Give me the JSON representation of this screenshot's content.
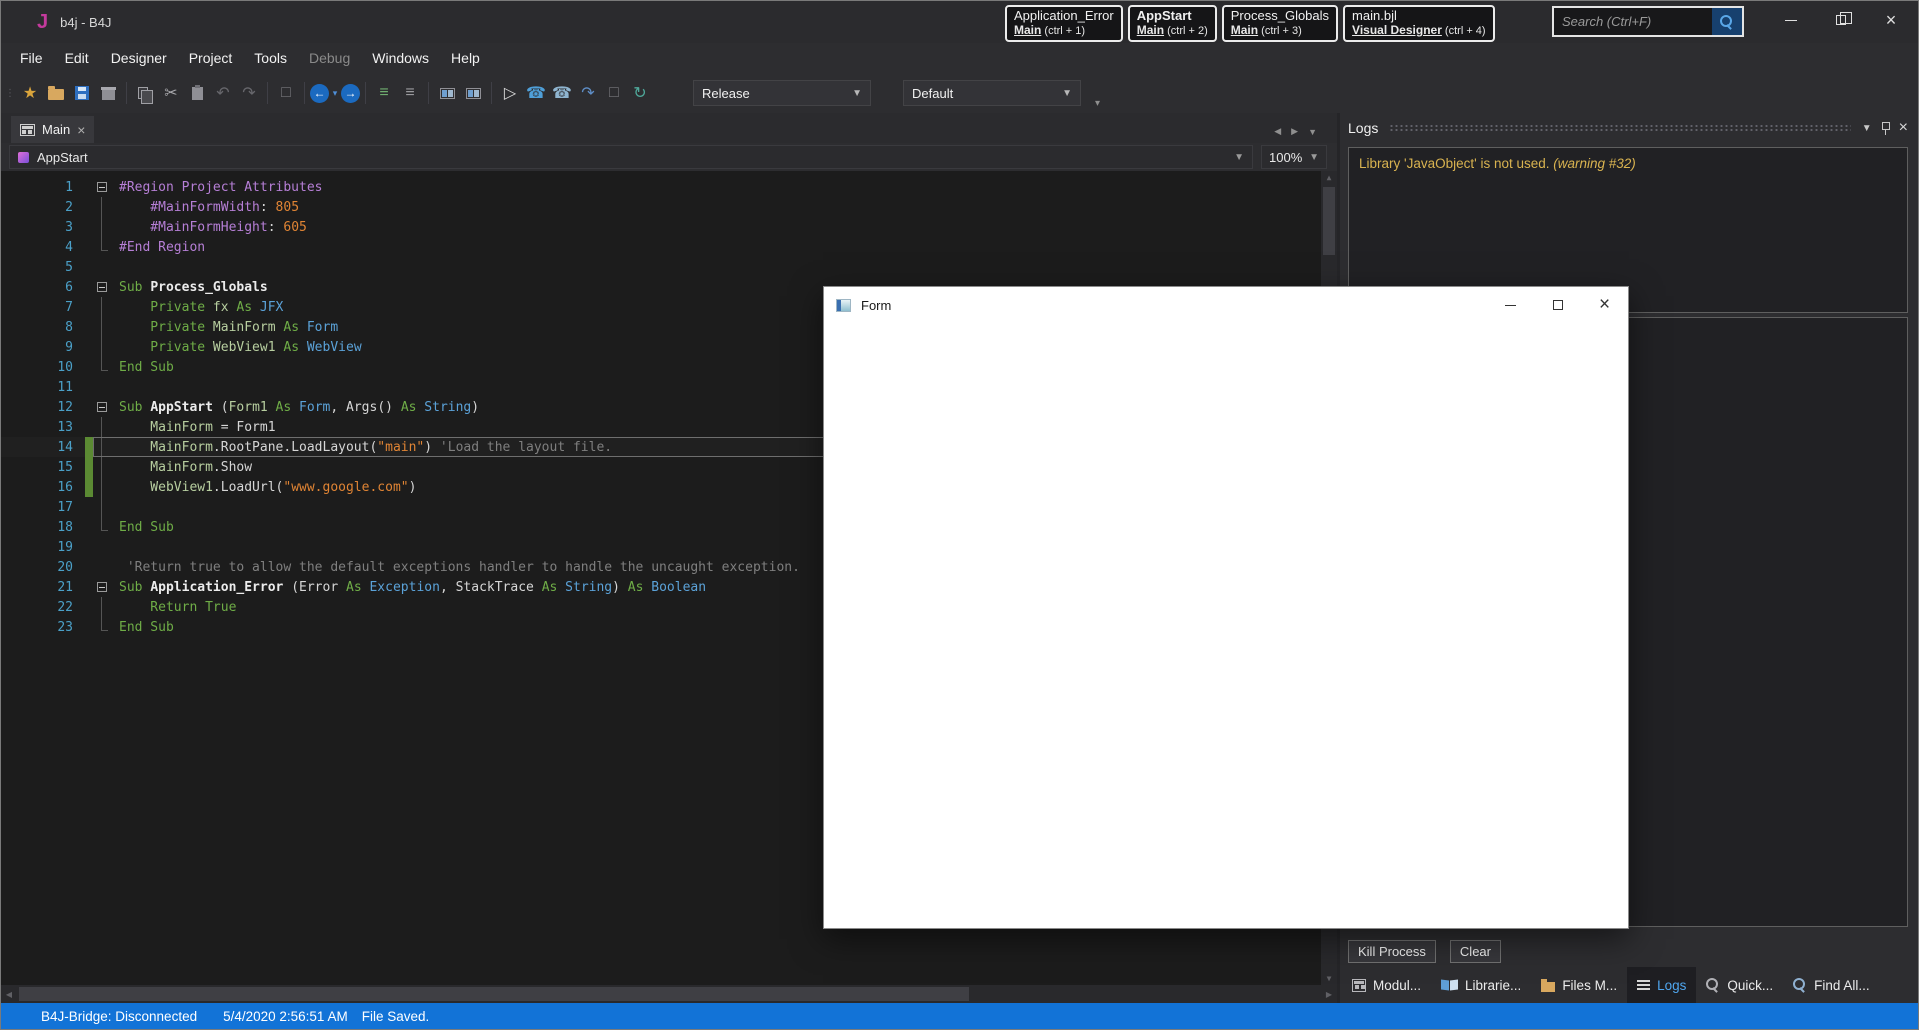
{
  "window": {
    "logo": "J",
    "title": "b4j - B4J"
  },
  "title_tabs": [
    {
      "line1": "Application_Error",
      "line2_main": "Main",
      "line2_hint": "(ctrl + 1)",
      "active": false
    },
    {
      "line1": "AppStart",
      "line2_main": "Main",
      "line2_hint": "(ctrl + 2)",
      "active": true
    },
    {
      "line1": "Process_Globals",
      "line2_main": "Main",
      "line2_hint": "(ctrl + 3)",
      "active": false
    },
    {
      "line1": "main.bjl",
      "line2_main": "Visual Designer",
      "line2_hint": "(ctrl + 4)",
      "active": false
    }
  ],
  "search": {
    "placeholder": "Search (Ctrl+F)"
  },
  "menubar": {
    "items": [
      {
        "label": "File",
        "enabled": true
      },
      {
        "label": "Edit",
        "enabled": true
      },
      {
        "label": "Designer",
        "enabled": true
      },
      {
        "label": "Project",
        "enabled": true
      },
      {
        "label": "Tools",
        "enabled": true
      },
      {
        "label": "Debug",
        "enabled": false
      },
      {
        "label": "Windows",
        "enabled": true
      },
      {
        "label": "Help",
        "enabled": true
      }
    ]
  },
  "toolbar": {
    "build_config": "Release",
    "run_config": "Default",
    "icons": [
      {
        "name": "new-project-icon",
        "glyph": "★",
        "color": "#d9a43c"
      },
      {
        "name": "open-project-icon",
        "css": "i-folder"
      },
      {
        "name": "save-icon",
        "css": "i-floppy"
      },
      {
        "name": "export-package-icon",
        "css": "i-package"
      },
      {
        "sep": true
      },
      {
        "name": "copy-icon",
        "css": "i-copy"
      },
      {
        "name": "cut-icon",
        "glyph": "✂",
        "color": "#a8a8ac"
      },
      {
        "name": "paste-icon",
        "css": "i-paste"
      },
      {
        "name": "undo-icon",
        "glyph": "↶",
        "color": "#67676c"
      },
      {
        "name": "redo-icon",
        "glyph": "↷",
        "color": "#67676c"
      },
      {
        "sep": true
      },
      {
        "name": "bookmark-icon",
        "glyph": "□",
        "color": "#77777c"
      },
      {
        "sep": true
      },
      {
        "name": "navigate-back-icon",
        "css": "i-circ",
        "glyph": "←"
      },
      {
        "name": "back-history-caret",
        "glyph": "▾",
        "color": "#4f8fd8",
        "small": true
      },
      {
        "name": "navigate-forward-icon",
        "css": "i-circ",
        "glyph": "→"
      },
      {
        "sep": true
      },
      {
        "name": "outline-icon",
        "glyph": "≡",
        "color": "#6fad6f"
      },
      {
        "name": "numbered-list-icon",
        "glyph": "≡",
        "color": "#9a9a9e"
      },
      {
        "sep": true
      },
      {
        "name": "split-editor-icon",
        "css": "i-panes"
      },
      {
        "name": "compare-modules-icon",
        "css": "i-panes"
      },
      {
        "sep": true
      },
      {
        "name": "run-icon",
        "glyph": "▷",
        "color": "#d8d8d8"
      },
      {
        "name": "bridge-icon",
        "glyph": "☎",
        "color": "#4f9fd8"
      },
      {
        "name": "wireless-bridge-icon",
        "glyph": "☎",
        "color": "#8fb5d0"
      },
      {
        "name": "resume-icon",
        "glyph": "↷",
        "color": "#5f8fc8"
      },
      {
        "name": "pause-icon",
        "glyph": "□",
        "color": "#77777c"
      },
      {
        "name": "rebuild-icon",
        "glyph": "↻",
        "color": "#4fa89a"
      }
    ]
  },
  "editor": {
    "tab_label": "Main",
    "selected_sub": "AppStart",
    "zoom": "100%",
    "lines": [
      {
        "n": 1,
        "fold": "box",
        "mark": false,
        "cur": false,
        "segs": [
          [
            "p",
            "#Region Project Attributes"
          ]
        ]
      },
      {
        "n": 2,
        "fold": "mid",
        "mark": false,
        "cur": false,
        "segs": [
          [
            "p",
            "    #MainFormWidth"
          ],
          [
            "w",
            ": "
          ],
          [
            "n",
            "805"
          ]
        ]
      },
      {
        "n": 3,
        "fold": "mid",
        "mark": false,
        "cur": false,
        "segs": [
          [
            "p",
            "    #MainFormHeight"
          ],
          [
            "w",
            ": "
          ],
          [
            "n",
            "605"
          ]
        ]
      },
      {
        "n": 4,
        "fold": "end",
        "mark": false,
        "cur": false,
        "segs": [
          [
            "p",
            "#End Region"
          ]
        ]
      },
      {
        "n": 5,
        "fold": "",
        "mark": false,
        "cur": false,
        "segs": []
      },
      {
        "n": 6,
        "fold": "box",
        "mark": false,
        "cur": false,
        "segs": [
          [
            "k",
            "Sub "
          ],
          [
            "b",
            "Process_Globals"
          ]
        ]
      },
      {
        "n": 7,
        "fold": "mid",
        "mark": false,
        "cur": false,
        "segs": [
          [
            "k",
            "    Private "
          ],
          [
            "v",
            "fx"
          ],
          [
            "k",
            " As "
          ],
          [
            "t",
            "JFX"
          ]
        ]
      },
      {
        "n": 8,
        "fold": "mid",
        "mark": false,
        "cur": false,
        "segs": [
          [
            "k",
            "    Private "
          ],
          [
            "v",
            "MainForm"
          ],
          [
            "k",
            " As "
          ],
          [
            "t",
            "Form"
          ]
        ]
      },
      {
        "n": 9,
        "fold": "mid",
        "mark": false,
        "cur": false,
        "segs": [
          [
            "k",
            "    Private "
          ],
          [
            "v",
            "WebView1"
          ],
          [
            "k",
            " As "
          ],
          [
            "t",
            "WebView"
          ]
        ]
      },
      {
        "n": 10,
        "fold": "end",
        "mark": false,
        "cur": false,
        "segs": [
          [
            "k",
            "End Sub"
          ]
        ]
      },
      {
        "n": 11,
        "fold": "",
        "mark": false,
        "cur": false,
        "segs": []
      },
      {
        "n": 12,
        "fold": "box",
        "mark": false,
        "cur": false,
        "segs": [
          [
            "k",
            "Sub "
          ],
          [
            "b",
            "AppStart"
          ],
          [
            "w",
            " ("
          ],
          [
            "v",
            "Form1"
          ],
          [
            "k",
            " As "
          ],
          [
            "t",
            "Form"
          ],
          [
            "w",
            ", Args() "
          ],
          [
            "k",
            "As "
          ],
          [
            "t",
            "String"
          ],
          [
            "w",
            ")"
          ]
        ]
      },
      {
        "n": 13,
        "fold": "mid",
        "mark": false,
        "cur": false,
        "segs": [
          [
            "v",
            "    MainForm"
          ],
          [
            "w",
            " = Form1"
          ]
        ]
      },
      {
        "n": 14,
        "fold": "mid",
        "mark": true,
        "cur": true,
        "segs": [
          [
            "v",
            "    MainForm"
          ],
          [
            "w",
            ".RootPane.LoadLayout("
          ],
          [
            "n",
            "\"main\""
          ],
          [
            "w",
            ") "
          ],
          [
            "c",
            "'Load the layout file."
          ]
        ]
      },
      {
        "n": 15,
        "fold": "mid",
        "mark": true,
        "cur": false,
        "segs": [
          [
            "v",
            "    MainForm"
          ],
          [
            "w",
            ".Show"
          ]
        ]
      },
      {
        "n": 16,
        "fold": "mid",
        "mark": true,
        "cur": false,
        "segs": [
          [
            "v",
            "    WebView1"
          ],
          [
            "w",
            ".LoadUrl("
          ],
          [
            "n",
            "\"www.google.com\""
          ],
          [
            "w",
            ")"
          ]
        ]
      },
      {
        "n": 17,
        "fold": "mid",
        "mark": false,
        "cur": false,
        "segs": []
      },
      {
        "n": 18,
        "fold": "end",
        "mark": false,
        "cur": false,
        "segs": [
          [
            "k",
            "End Sub"
          ]
        ]
      },
      {
        "n": 19,
        "fold": "",
        "mark": false,
        "cur": false,
        "segs": []
      },
      {
        "n": 20,
        "fold": "",
        "mark": false,
        "cur": false,
        "segs": [
          [
            "c",
            " 'Return true to allow the default exceptions handler to handle the uncaught exception."
          ]
        ]
      },
      {
        "n": 21,
        "fold": "box",
        "mark": false,
        "cur": false,
        "segs": [
          [
            "k",
            "Sub "
          ],
          [
            "b",
            "Application_Error"
          ],
          [
            "w",
            " (Error "
          ],
          [
            "k",
            "As "
          ],
          [
            "t",
            "Exception"
          ],
          [
            "w",
            ", StackTrace "
          ],
          [
            "k",
            "As "
          ],
          [
            "t",
            "String"
          ],
          [
            "w",
            ") "
          ],
          [
            "k",
            "As "
          ],
          [
            "t",
            "Boolean"
          ]
        ]
      },
      {
        "n": 22,
        "fold": "mid",
        "mark": false,
        "cur": false,
        "segs": [
          [
            "k",
            "    Return True"
          ]
        ]
      },
      {
        "n": 23,
        "fold": "end",
        "mark": false,
        "cur": false,
        "segs": [
          [
            "k",
            "End Sub"
          ]
        ]
      }
    ]
  },
  "logs": {
    "title": "Logs",
    "warning_text": "Library 'JavaObject' is not used. ",
    "warning_suffix": "(warning #32)",
    "kill_button": "Kill Process",
    "clear_button": "Clear"
  },
  "bottom_tabs": [
    {
      "label": "Modul...",
      "icon": "modules-icon",
      "css": "i-module",
      "active": false
    },
    {
      "label": "Librarie...",
      "icon": "libraries-icon",
      "css": "i-book",
      "active": false
    },
    {
      "label": "Files M...",
      "icon": "files-manager-icon",
      "css": "i-folderS",
      "active": false
    },
    {
      "label": "Logs",
      "icon": "logs-icon",
      "css": "i-lines",
      "active": true
    },
    {
      "label": "Quick...",
      "icon": "quick-search-icon",
      "css": "i-mag",
      "active": false
    },
    {
      "label": "Find All...",
      "icon": "find-all-icon",
      "css": "i-mag i-magwin",
      "active": false
    }
  ],
  "status_bar": {
    "bridge": "B4J-Bridge: Disconnected",
    "timestamp": "5/4/2020 2:56:51 AM",
    "message": "File Saved."
  },
  "form_window": {
    "title": "Form"
  }
}
